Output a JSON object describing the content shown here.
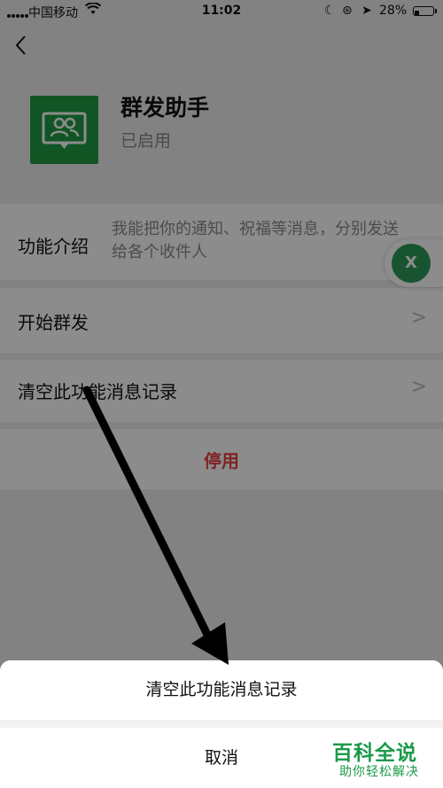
{
  "status_bar": {
    "carrier": "中国移动",
    "time": "11:02",
    "battery_percent": "28%",
    "battery_level": 0.28
  },
  "header": {
    "back_icon": "chevron-left-icon"
  },
  "app": {
    "name": "群发助手",
    "status": "已启用",
    "icon": "group-chat-icon",
    "icon_color": "#1f9b42"
  },
  "rows": {
    "intro_label": "功能介绍",
    "intro_desc": "我能把你的通知、祝福等消息，分别发送给各个收件人",
    "start_label": "开始群发",
    "clear_label": "清空此功能消息记录",
    "disable_label": "停用",
    "disable_color": "#e64340"
  },
  "floating_button": {
    "label": "X"
  },
  "action_sheet": {
    "confirm_label": "清空此功能消息记录",
    "cancel_label": "取消"
  },
  "watermark": {
    "title": "百科全说",
    "subtitle": "助你轻松解决"
  }
}
